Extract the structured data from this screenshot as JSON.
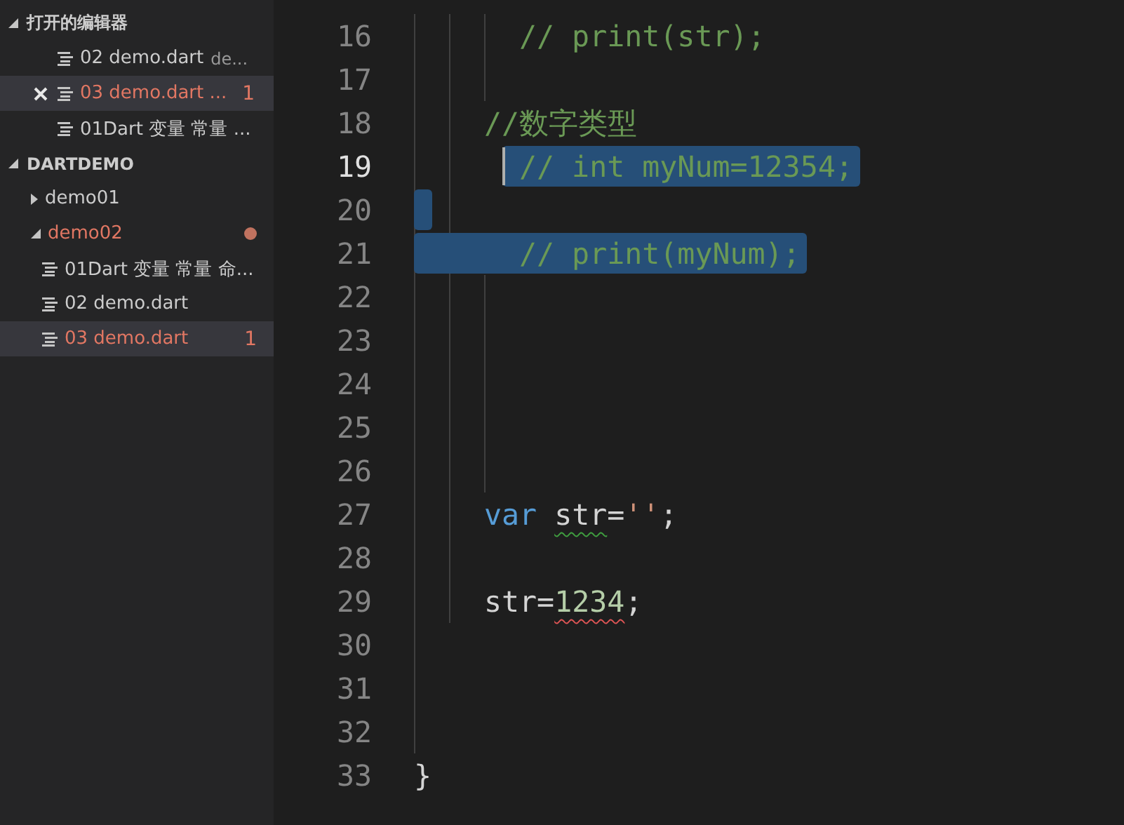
{
  "sidebar": {
    "open_editors": {
      "title": "打开的编辑器",
      "expanded": true,
      "items": [
        {
          "name": "02 demo.dart",
          "description": "de...",
          "selected": false,
          "error": false,
          "closable": false
        },
        {
          "name": "03 demo.dart ...",
          "badge": "1",
          "selected": true,
          "error": true,
          "closable": true
        },
        {
          "name": "01Dart 变量 常量 ...",
          "selected": false,
          "error": false,
          "closable": false
        }
      ]
    },
    "explorer": {
      "title": "DARTDEMO",
      "expanded": true,
      "items": [
        {
          "kind": "folder",
          "name": "demo01",
          "expanded": false,
          "error": false,
          "selected": false
        },
        {
          "kind": "folder",
          "name": "demo02",
          "expanded": true,
          "error": true,
          "selected": false,
          "children": [
            {
              "kind": "file",
              "name": "01Dart 变量 常量 命...",
              "error": false,
              "selected": false
            },
            {
              "kind": "file",
              "name": "02 demo.dart",
              "error": false,
              "selected": false
            },
            {
              "kind": "file",
              "name": "03 demo.dart",
              "badge": "1",
              "error": true,
              "selected": true
            }
          ]
        }
      ]
    }
  },
  "editor": {
    "lines": [
      {
        "number": "16",
        "selected": false,
        "cursor": false,
        "kind": "inner",
        "tokens": [
          {
            "kind": "comment",
            "text": "// print(str);"
          }
        ]
      },
      {
        "number": "17",
        "selected": false,
        "cursor": false
      },
      {
        "number": "18",
        "selected": false,
        "cursor": false,
        "kind": "body",
        "tokens": [
          {
            "kind": "comment",
            "text": "//数字类型"
          }
        ]
      },
      {
        "number": "19",
        "selected": true,
        "cursor": true,
        "kind": "inner",
        "tokens": [
          {
            "kind": "comment",
            "text": "// int myNum=12354;"
          }
        ]
      },
      {
        "number": "20",
        "selected": true,
        "cursor": false
      },
      {
        "number": "21",
        "selected": true,
        "cursor": false,
        "kind": "inner",
        "tokens": [
          {
            "kind": "comment",
            "text": "// print(myNum);"
          }
        ]
      },
      {
        "number": "22",
        "selected": false,
        "cursor": false
      },
      {
        "number": "23",
        "selected": false,
        "cursor": false
      },
      {
        "number": "24",
        "selected": false,
        "cursor": false
      },
      {
        "number": "25",
        "selected": false,
        "cursor": false
      },
      {
        "number": "26",
        "selected": false,
        "cursor": false
      },
      {
        "number": "27",
        "selected": false,
        "cursor": false,
        "kind": "body",
        "tokens": [
          {
            "kind": "keyword",
            "text": "var"
          },
          {
            "kind": "plain",
            "text": "str",
            "warning": true
          },
          {
            "kind": "plain",
            "text": "="
          },
          {
            "kind": "string",
            "text": "''"
          },
          {
            "kind": "plain",
            "text": ";"
          }
        ]
      },
      {
        "number": "28",
        "selected": false,
        "cursor": false
      },
      {
        "number": "29",
        "selected": false,
        "cursor": false,
        "kind": "body",
        "tokens": [
          {
            "kind": "plain",
            "text": "str="
          },
          {
            "kind": "number",
            "text": "1234",
            "error": true
          },
          {
            "kind": "plain",
            "text": ";"
          }
        ]
      },
      {
        "number": "30",
        "selected": false,
        "cursor": false
      },
      {
        "number": "31",
        "selected": false,
        "cursor": false
      },
      {
        "number": "32",
        "selected": false,
        "cursor": false
      },
      {
        "number": "33",
        "selected": false,
        "cursor": false,
        "kind": "top",
        "tokens": [
          {
            "kind": "plain",
            "text": "}"
          }
        ]
      }
    ]
  }
}
